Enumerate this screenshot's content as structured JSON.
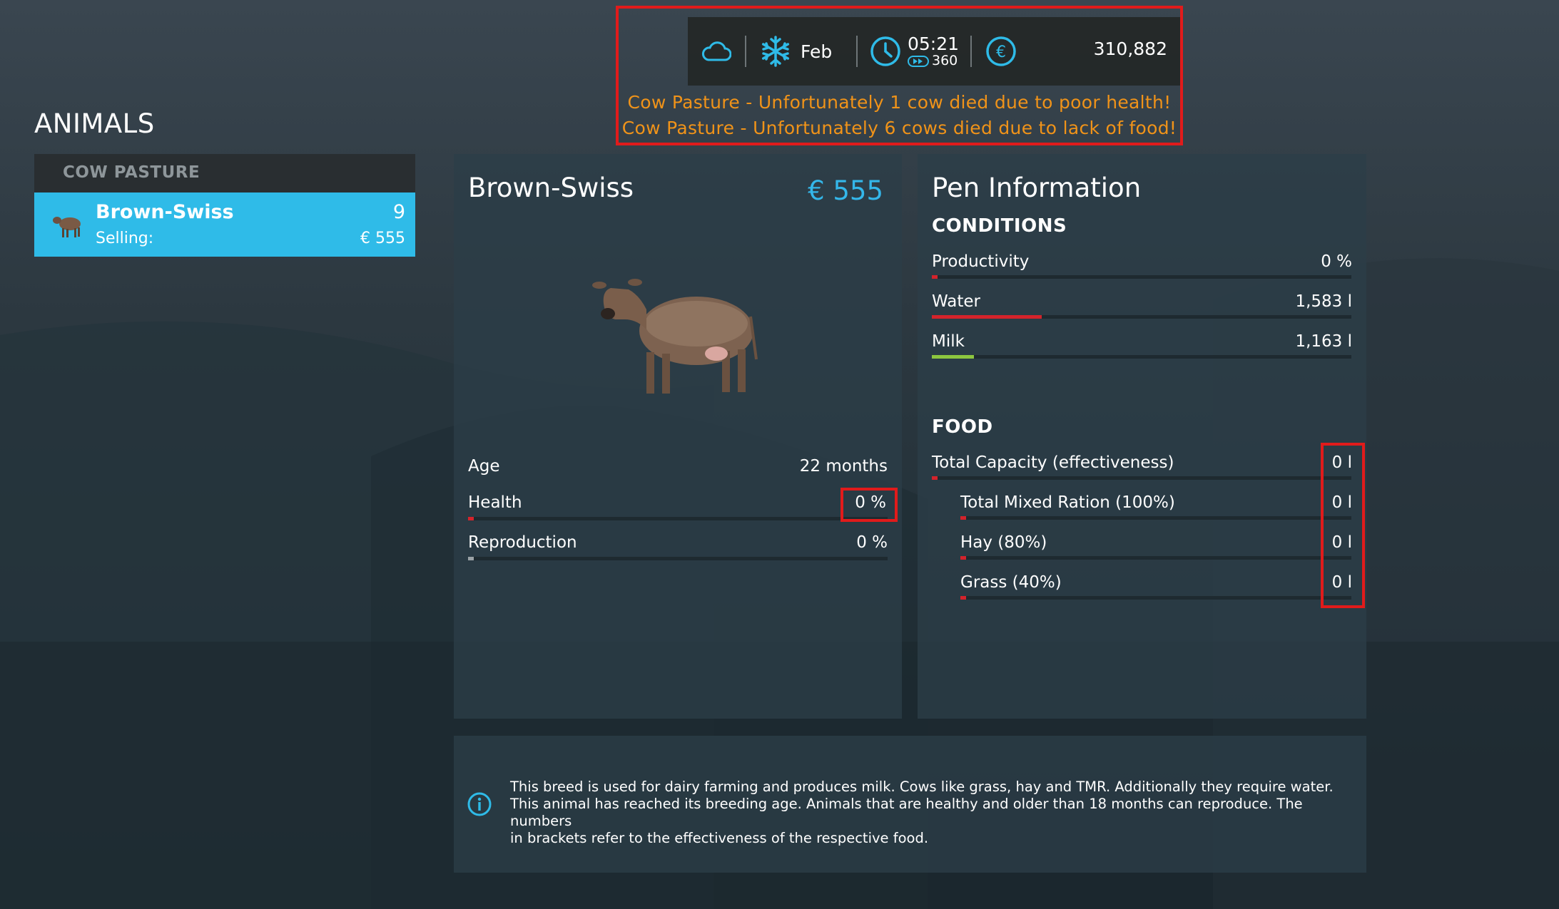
{
  "hud": {
    "weather_icon": "cloud-icon",
    "season_icon": "snowflake-icon",
    "month": "Feb",
    "clock_icon": "clock-icon",
    "time": "05:21",
    "speed_icon": "fast-forward-icon",
    "speed": "360",
    "currency_icon": "euro-icon",
    "money": "310,882",
    "messages": [
      "Cow Pasture - Unfortunately 1 cow died due to poor health!",
      "Cow Pasture - Unfortunately 6 cows died due to lack of food!"
    ]
  },
  "sidebar": {
    "title": "ANIMALS",
    "group": "COW PASTURE",
    "items": [
      {
        "name": "Brown-Swiss",
        "count": "9",
        "selling_label": "Selling:",
        "price": "€ 555"
      }
    ]
  },
  "detail": {
    "title": "Brown-Swiss",
    "price": "€ 555",
    "stats": {
      "age": {
        "label": "Age",
        "value": "22 months"
      },
      "health": {
        "label": "Health",
        "value": "0 %",
        "level": 0
      },
      "reproduction": {
        "label": "Reproduction",
        "value": "0 %",
        "level": 0
      }
    }
  },
  "pen": {
    "title": "Pen Information",
    "conditions_title": "CONDITIONS",
    "conditions": {
      "productivity": {
        "label": "Productivity",
        "value": "0 %",
        "level": 0
      },
      "water": {
        "label": "Water",
        "value": "1,583 l",
        "level": 0.26
      },
      "milk": {
        "label": "Milk",
        "value": "1,163 l",
        "level": 0.1
      }
    },
    "food_title": "FOOD",
    "food": {
      "total": {
        "label": "Total Capacity (effectiveness)",
        "value": "0 l",
        "level": 0
      },
      "tmr": {
        "label": "Total Mixed Ration (100%)",
        "value": "0 l",
        "level": 0
      },
      "hay": {
        "label": "Hay (80%)",
        "value": "0 l",
        "level": 0
      },
      "grass": {
        "label": "Grass (40%)",
        "value": "0 l",
        "level": 0
      }
    }
  },
  "info": {
    "icon": "info-icon",
    "lines": [
      "This breed is used for dairy farming and produces milk. Cows like grass, hay and TMR. Additionally they require water.",
      "This animal has reached its breeding age. Animals that are healthy and older than 18 months can reproduce. The numbers",
      "in brackets refer to the effectiveness of the respective food."
    ]
  },
  "colors": {
    "accent": "#2fbbe8",
    "price_blue": "#34b7ea",
    "warning": "#f09319",
    "highlight_red": "#e11b1b",
    "bar_red": "#d4232b",
    "bar_green": "#8dc63f",
    "bar_gray": "#9aa2a6"
  }
}
